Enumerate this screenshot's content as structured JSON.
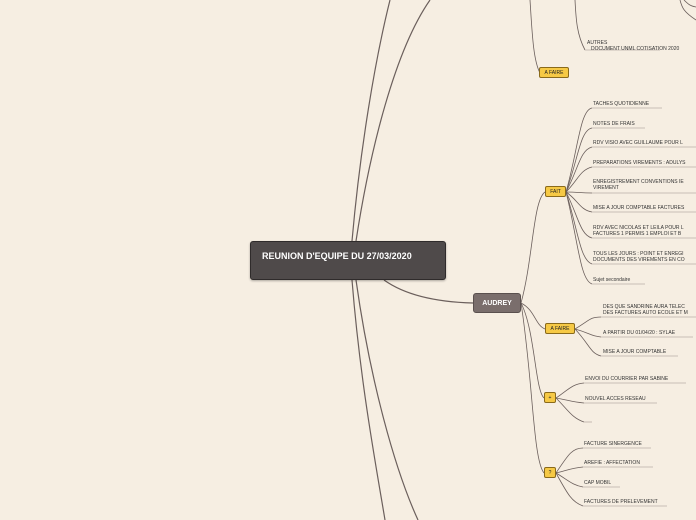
{
  "central": {
    "title": "REUNION D'EQUIPE DU 27/03/2020"
  },
  "top_fragment": {
    "autres": "AUTRES",
    "document_unml": "DOCUMENT UNML COTISATION 2020",
    "a_faire": "A FAIRE"
  },
  "audrey": {
    "label": "AUDREY",
    "fait": {
      "label": "FAIT",
      "items": [
        "TACHES QUOTIDIENNE",
        "NOTES DE FRAIS",
        "RDV VISIO AVEC GUILLAUME POUR L",
        "PREPARATIONS VIREMENTS : ADULYS",
        "ENREGISTREMENT CONVENTIONS IE",
        "VIREMENT",
        "MISE A JOUR COMPTABLE FACTURES",
        "RDV AVEC NICOLAS ET LEILA POUR L",
        "FACTURES 1 PERMIS 1 EMPLOI  ET B",
        "TOUS LES JOURS : POINT ET ENREGI",
        "DOCUMENTS DES VIREMENTS EN CO",
        "Sujet secondaire"
      ]
    },
    "a_faire": {
      "label": "A FAIRE",
      "items": [
        "DES QUE SANDRINE AURA TELEC",
        "DES FACTURES AUTO ECOLE ET M",
        "A PARTIR DU 01/04/20 : SYLAE",
        "MISE A JOUR COMPTABLE"
      ]
    },
    "plus": {
      "label": "+",
      "items": [
        "ENVOI DU COURRIER PAR SABINE",
        "NOUVEL ACCES RESEAU",
        ""
      ]
    },
    "question": {
      "label": "?",
      "items": [
        "FACTURE SINERGENCE",
        "AREFIE : AFFECTATION",
        "CAP MOBIL",
        "FACTURES DE PRELEVEMENT"
      ]
    }
  },
  "colors": {
    "background": "#f6eee2",
    "central": "#4f4a4a",
    "main": "#7a6e6c",
    "sub": "#f6c945",
    "line": "#6b5f5c"
  }
}
